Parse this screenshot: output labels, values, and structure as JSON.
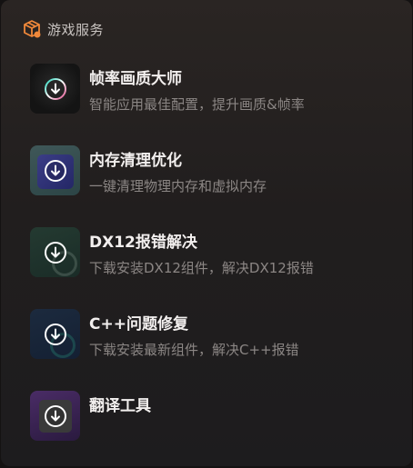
{
  "panel": {
    "title": "游戏服务",
    "logo_icon": "package-box-icon",
    "accent": "#f0883a"
  },
  "items": [
    {
      "name": "帧率画质大师",
      "desc": "智能应用最佳配置，提升画质&帧率",
      "icon": "download-circle-icon"
    },
    {
      "name": "内存清理优化",
      "desc": "一键清理物理内存和虚拟内存",
      "icon": "download-circle-icon"
    },
    {
      "name": "DX12报错解决",
      "desc": "下载安装DX12组件，解决DX12报错",
      "icon": "download-circle-icon"
    },
    {
      "name": "C++问题修复",
      "desc": "下载安装最新组件，解决C++报错",
      "icon": "download-circle-icon"
    },
    {
      "name": "翻译工具",
      "desc": "",
      "icon": "download-circle-icon"
    }
  ]
}
